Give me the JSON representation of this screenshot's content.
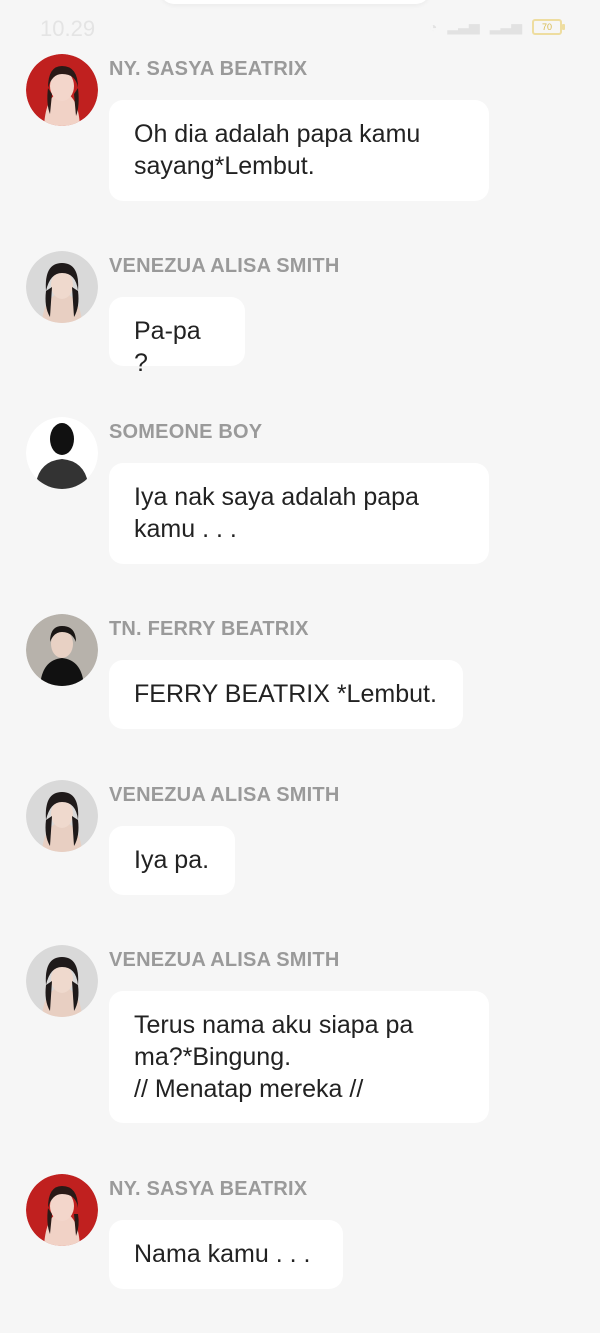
{
  "status_bar": {
    "time": "10.29",
    "battery": "70"
  },
  "messages": [
    {
      "sender": "NY. SASYA BEATRIX",
      "avatar_icon": "woman-red-avatar",
      "lines": [
        "Oh dia adalah papa kamu",
        "sayang*Lembut."
      ]
    },
    {
      "sender": "VENEZUA ALISA SMITH",
      "avatar_icon": "woman-dark-hair-avatar",
      "lines": [
        "Pa-pa ?"
      ]
    },
    {
      "sender": "SOMEONE BOY",
      "avatar_icon": "silhouette-avatar",
      "lines": [
        "Iya nak saya adalah papa",
        "kamu . . ."
      ]
    },
    {
      "sender": "TN. FERRY BEATRIX",
      "avatar_icon": "man-avatar",
      "lines": [
        "FERRY BEATRIX *Lembut."
      ]
    },
    {
      "sender": "VENEZUA ALISA SMITH",
      "avatar_icon": "woman-dark-hair-avatar",
      "lines": [
        "Iya pa."
      ]
    },
    {
      "sender": "VENEZUA ALISA SMITH",
      "avatar_icon": "woman-dark-hair-avatar",
      "lines": [
        "Terus nama aku siapa pa",
        "ma?*Bingung.",
        "// Menatap mereka //"
      ]
    },
    {
      "sender": "NY. SASYA BEATRIX",
      "avatar_icon": "woman-red-avatar",
      "lines": [
        "Nama kamu . . ."
      ]
    }
  ]
}
